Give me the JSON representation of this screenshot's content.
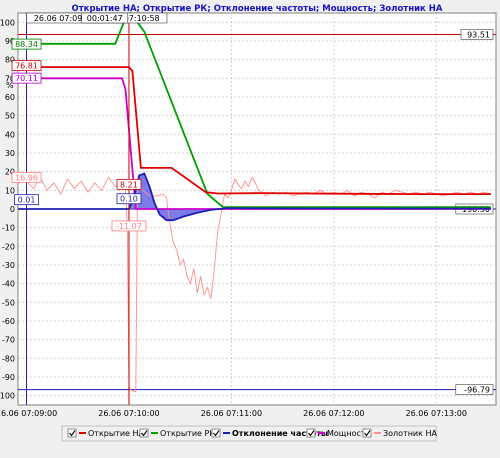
{
  "chart_data": {
    "type": "line",
    "title": "Открытие НА; Открытие РК; Отклонение частоты; Мощность; Золотник НА",
    "x_unit": "seconds after 26.06 07:09:00",
    "x_ticks": [
      {
        "t": 0,
        "label": "26.06 07:09:00"
      },
      {
        "t": 60,
        "label": "26.06 07:10:00"
      },
      {
        "t": 120,
        "label": "26.06 07:11:00"
      },
      {
        "t": 180,
        "label": "26.06 07:12:00"
      },
      {
        "t": 240,
        "label": "26.06 07:13:00"
      }
    ],
    "xlim": [
      -5,
      275
    ],
    "ylim": [
      -105,
      105
    ],
    "y_ticks": [
      100,
      90,
      80,
      70,
      60,
      50,
      40,
      30,
      20,
      10,
      0,
      -10,
      -20,
      -30,
      -40,
      -50,
      -60,
      -70,
      -80,
      -90,
      -100
    ],
    "y_axis_symbol": "%",
    "grid": true,
    "legend_position": "bottom",
    "cursors": [
      {
        "t": 0,
        "label": "26.06 07:09:11",
        "color": "#1e1eb4"
      },
      {
        "t": 60,
        "label": "26.06 07:10:58",
        "color": "#c80000"
      }
    ],
    "span_label": "00:01:47",
    "h_lines": [
      {
        "y": 93.51,
        "label": "93.51",
        "color": "#c80000"
      },
      {
        "y": -96.79,
        "label": "-96.79",
        "color": "#1e1eb4"
      },
      {
        "y": 0,
        "label": "190.30",
        "color": "#1e1eb4"
      }
    ],
    "value_tags": [
      {
        "y": 88.34,
        "at": "cursor1",
        "label": "88.34",
        "color": "#008000"
      },
      {
        "y": 76.81,
        "at": "cursor1",
        "label": "76.81",
        "color": "#c80000"
      },
      {
        "y": 70.11,
        "at": "cursor1",
        "label": "70.11",
        "color": "#aa00cc"
      },
      {
        "y": 16.96,
        "at": "cursor1",
        "label": "16.96",
        "color": "#ff8080"
      },
      {
        "y": 5.0,
        "at": "cursor1",
        "label": "0.01",
        "color": "#1e1eb4"
      },
      {
        "y": 13.21,
        "at": "cursor2",
        "label": "8.21",
        "color": "#c80000"
      },
      {
        "y": 5.5,
        "at": "cursor2",
        "label": "0.10",
        "color": "#1e1eb4"
      },
      {
        "y": -9.07,
        "at": "cursor2",
        "label": "-11.07",
        "color": "#ff8080"
      }
    ],
    "series": [
      {
        "name": "Открытие НА",
        "color": "#e00000",
        "points": [
          [
            -5,
            76
          ],
          [
            60,
            76
          ],
          [
            62,
            74
          ],
          [
            67,
            22
          ],
          [
            85,
            22
          ],
          [
            105,
            9
          ],
          [
            112,
            8.3
          ],
          [
            140,
            8.5
          ],
          [
            180,
            8.2
          ],
          [
            230,
            8
          ],
          [
            272,
            8
          ]
        ]
      },
      {
        "name": "Открытие РК",
        "color": "#00a000",
        "points": [
          [
            -5,
            88.5
          ],
          [
            52,
            88.5
          ],
          [
            57,
            100
          ],
          [
            61,
            105
          ],
          [
            69,
            95
          ],
          [
            106,
            8
          ],
          [
            115,
            1
          ],
          [
            272,
            1
          ]
        ]
      },
      {
        "name": "Отклонение частоты",
        "color": "#1e1eb4",
        "points": [
          [
            -5,
            0
          ],
          [
            60,
            0
          ],
          [
            63,
            7
          ],
          [
            66,
            18
          ],
          [
            69,
            19
          ],
          [
            72,
            12
          ],
          [
            75,
            3
          ],
          [
            78,
            -3
          ],
          [
            82,
            -6
          ],
          [
            86,
            -6
          ],
          [
            92,
            -4
          ],
          [
            100,
            -2
          ],
          [
            108,
            -0.5
          ],
          [
            118,
            0.5
          ],
          [
            135,
            0.3
          ],
          [
            272,
            0.2
          ]
        ]
      },
      {
        "name": "Мощность",
        "color": "#cc00cc",
        "points": [
          [
            -5,
            70
          ],
          [
            56,
            70
          ],
          [
            58,
            64
          ],
          [
            64,
            0
          ],
          [
            272,
            0
          ]
        ]
      },
      {
        "name": "Золотник НА",
        "color": "#ff8e8e",
        "points": [
          [
            -5,
            14
          ],
          [
            0,
            15
          ],
          [
            4,
            11
          ],
          [
            8,
            17
          ],
          [
            12,
            10
          ],
          [
            16,
            14
          ],
          [
            20,
            8
          ],
          [
            24,
            16
          ],
          [
            28,
            11
          ],
          [
            32,
            15
          ],
          [
            36,
            9
          ],
          [
            40,
            14
          ],
          [
            44,
            10
          ],
          [
            48,
            17
          ],
          [
            52,
            12
          ],
          [
            56,
            14
          ],
          [
            58,
            10
          ],
          [
            59,
            -10
          ],
          [
            60,
            -95
          ],
          [
            61,
            -97
          ],
          [
            64,
            -98
          ],
          [
            65,
            12
          ],
          [
            68,
            10
          ],
          [
            72,
            7
          ],
          [
            76,
            7
          ],
          [
            80,
            8
          ],
          [
            82,
            6
          ],
          [
            84,
            -8
          ],
          [
            86,
            -18
          ],
          [
            88,
            -22
          ],
          [
            90,
            -30
          ],
          [
            92,
            -27
          ],
          [
            94,
            -36
          ],
          [
            96,
            -40
          ],
          [
            98,
            -32
          ],
          [
            100,
            -45
          ],
          [
            102,
            -36
          ],
          [
            104,
            -46
          ],
          [
            106,
            -42
          ],
          [
            108,
            -48
          ],
          [
            110,
            -32
          ],
          [
            112,
            -12
          ],
          [
            114,
            -2
          ],
          [
            116,
            8
          ],
          [
            118,
            6
          ],
          [
            120,
            10
          ],
          [
            122,
            16
          ],
          [
            124,
            13
          ],
          [
            126,
            11
          ],
          [
            128,
            15
          ],
          [
            130,
            12
          ],
          [
            132,
            17
          ],
          [
            134,
            14
          ],
          [
            136,
            10
          ],
          [
            138,
            9
          ],
          [
            140,
            7
          ],
          [
            144,
            9
          ],
          [
            148,
            8
          ],
          [
            152,
            9
          ],
          [
            156,
            7
          ],
          [
            160,
            8
          ],
          [
            164,
            9
          ],
          [
            168,
            8
          ],
          [
            172,
            10
          ],
          [
            176,
            8
          ],
          [
            180,
            9
          ],
          [
            184,
            8
          ],
          [
            188,
            10
          ],
          [
            192,
            7
          ],
          [
            196,
            9
          ],
          [
            200,
            8
          ],
          [
            204,
            6
          ],
          [
            208,
            9
          ],
          [
            212,
            8
          ],
          [
            216,
            10
          ],
          [
            220,
            9
          ],
          [
            224,
            8
          ],
          [
            228,
            9
          ],
          [
            232,
            8
          ],
          [
            236,
            9
          ],
          [
            240,
            8
          ],
          [
            244,
            7
          ],
          [
            248,
            8
          ],
          [
            252,
            9
          ],
          [
            256,
            8
          ],
          [
            260,
            9
          ],
          [
            264,
            8
          ],
          [
            268,
            9
          ],
          [
            272,
            8
          ]
        ]
      }
    ]
  }
}
